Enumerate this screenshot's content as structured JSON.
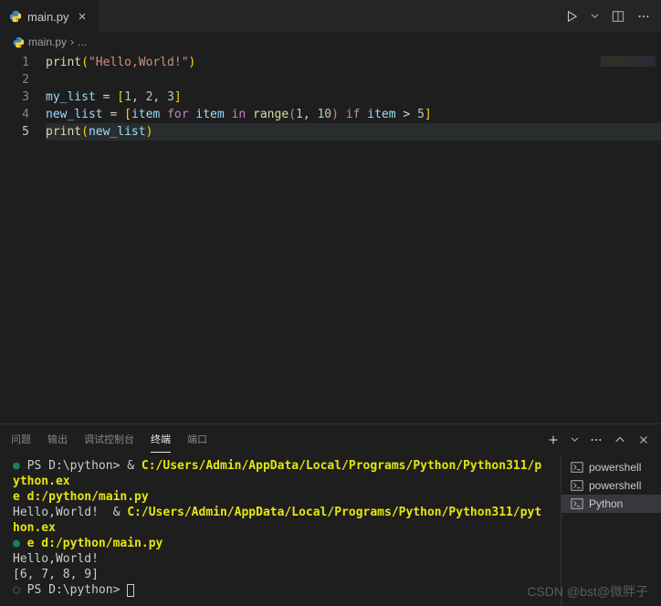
{
  "tab": {
    "filename": "main.py"
  },
  "breadcrumb": {
    "file": "main.py",
    "sep": "›",
    "rest": "..."
  },
  "code": {
    "lines": [
      "1",
      "2",
      "3",
      "4",
      "5"
    ]
  },
  "line1": {
    "fn": "print",
    "lp": "(",
    "str": "\"Hello,World!\"",
    "rp": ")"
  },
  "line3": {
    "v": "my_list",
    "eq": " = ",
    "lb": "[",
    "a": "1",
    "c1": ", ",
    "b": "2",
    "c2": ", ",
    "c": "3",
    "rb": "]"
  },
  "line4": {
    "v": "new_list",
    "eq": " = ",
    "lb": "[",
    "item1": "item ",
    "for": "for",
    "item2": " item ",
    "in": "in",
    "sp": " ",
    "range": "range",
    "lp": "(",
    "a": "1",
    "cm": ", ",
    "b": "10",
    "rp": ")",
    "sp2": " ",
    "if": "if",
    "item3": " item ",
    "gt": "> ",
    "five": "5",
    "rb": "]"
  },
  "line5": {
    "fn": "print",
    "lp": "(",
    "v": "new_list",
    "rp": ")"
  },
  "panel": {
    "tabs": {
      "problems": "问题",
      "output": "输出",
      "debug": "调试控制台",
      "terminal": "终端",
      "ports": "端口"
    }
  },
  "terminal": {
    "ps": "PS ",
    "path": "D:\\python",
    "gt": "> ",
    "amp": "& ",
    "exe": "C:/Users/Admin/AppData/Local/Programs/Python/Python311/python.ex",
    "exe2": "e d:/python/main.py",
    "out1": "Hello,World!  ",
    "out2": "Hello,World!",
    "out3": "[6, 7, 8, 9]"
  },
  "termSidebar": {
    "a": "powershell",
    "b": "powershell",
    "c": "Python"
  },
  "watermark": "CSDN @bst@微胖子"
}
